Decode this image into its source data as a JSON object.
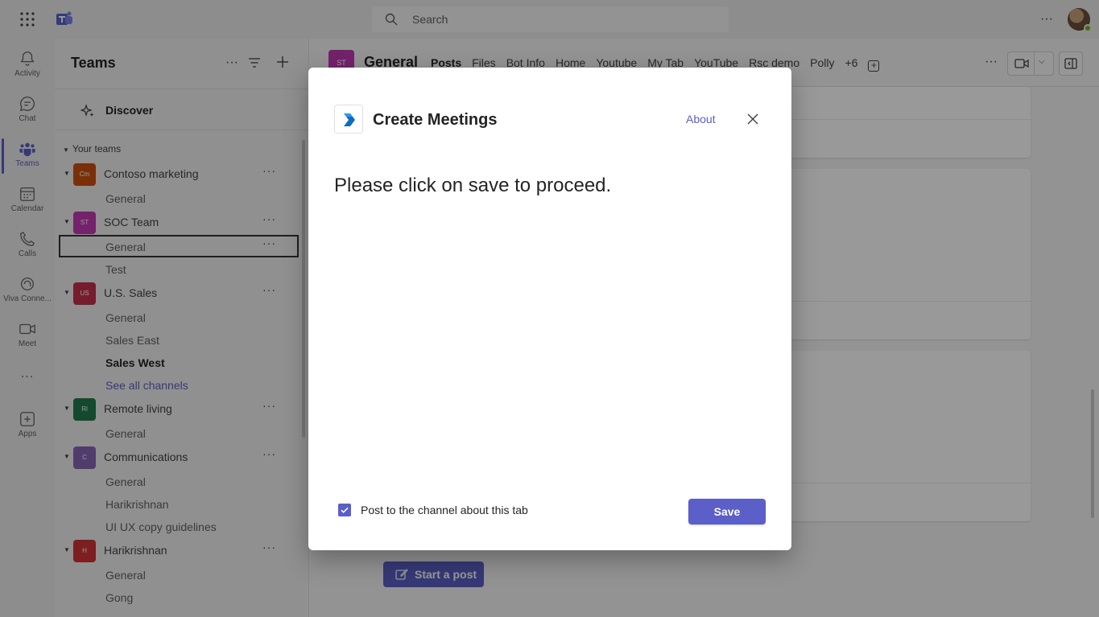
{
  "search": {
    "placeholder": "Search"
  },
  "rail": [
    {
      "label": "Activity",
      "icon": "bell-icon"
    },
    {
      "label": "Chat",
      "icon": "chat-icon"
    },
    {
      "label": "Teams",
      "icon": "teams-icon",
      "active": true
    },
    {
      "label": "Calendar",
      "icon": "calendar-icon"
    },
    {
      "label": "Calls",
      "icon": "phone-icon"
    },
    {
      "label": "Viva Conne...",
      "icon": "viva-icon"
    },
    {
      "label": "Meet",
      "icon": "video-icon"
    },
    {
      "label": "...",
      "icon": "more-icon"
    },
    {
      "label": "Apps",
      "icon": "apps-icon"
    }
  ],
  "pane": {
    "title": "Teams",
    "discover": "Discover",
    "your_teams": "Your teams",
    "teams": [
      {
        "initials": "Cm",
        "name": "Contoso marketing",
        "color": "#ca5010",
        "channels": [
          {
            "name": "General"
          }
        ]
      },
      {
        "initials": "ST",
        "name": "SOC Team",
        "color": "#c239b3",
        "channels": [
          {
            "name": "General",
            "selected": true
          },
          {
            "name": "Test"
          }
        ]
      },
      {
        "initials": "US",
        "name": "U.S. Sales",
        "color": "#c4314b",
        "channels": [
          {
            "name": "General"
          },
          {
            "name": "Sales East"
          },
          {
            "name": "Sales West",
            "bold": true
          },
          {
            "name": "See all channels",
            "link": true
          }
        ]
      },
      {
        "initials": "Rl",
        "name": "Remote living",
        "color": "#237b4b",
        "channels": [
          {
            "name": "General"
          }
        ]
      },
      {
        "initials": "C",
        "name": "Communications",
        "color": "#8764b8",
        "channels": [
          {
            "name": "General"
          },
          {
            "name": "Harikrishnan"
          },
          {
            "name": "UI UX copy guidelines"
          }
        ]
      },
      {
        "initials": "H",
        "name": "Harikrishnan",
        "color": "#d13438",
        "channels": [
          {
            "name": "General"
          },
          {
            "name": "Gong"
          }
        ]
      }
    ]
  },
  "channel": {
    "initials": "ST",
    "name": "General",
    "tabs": [
      "Posts",
      "Files",
      "Bot Info",
      "Home",
      "Youtube",
      "My Tab",
      "YouTube",
      "Rsc demo",
      "Polly"
    ],
    "more_tabs": "+6",
    "start_post": "Start a post"
  },
  "dialog": {
    "title": "Create Meetings",
    "about": "About",
    "message": "Please click on save to proceed.",
    "checkbox_label": "Post to the channel about this tab",
    "checkbox_checked": true,
    "save": "Save"
  },
  "colors": {
    "accent": "#5b5fc7"
  }
}
